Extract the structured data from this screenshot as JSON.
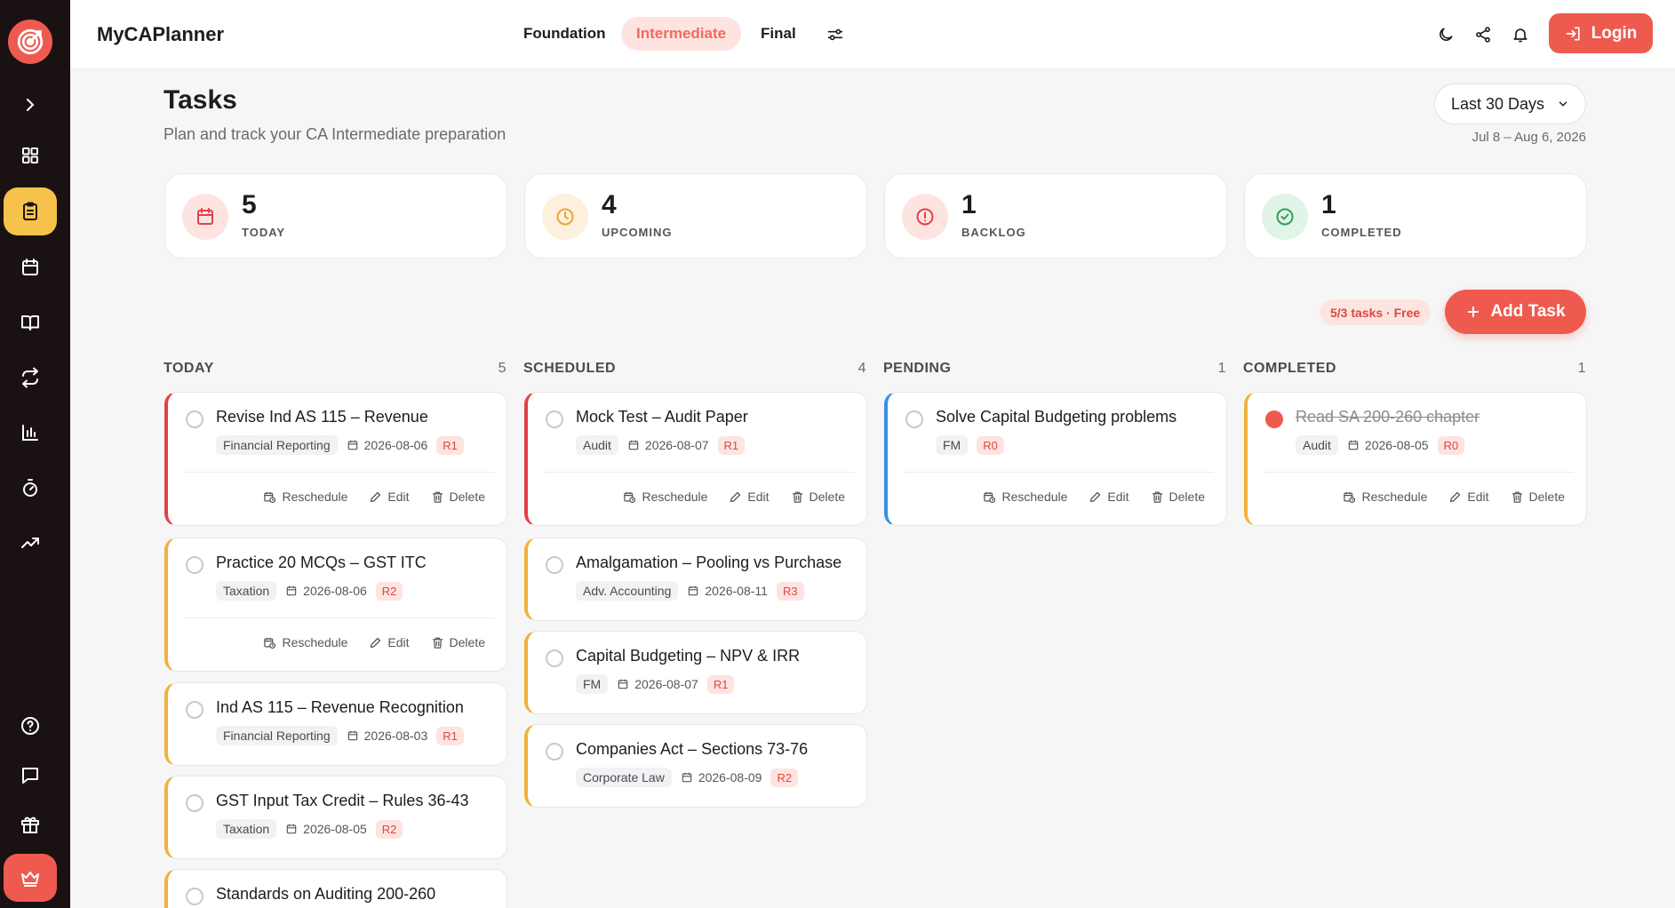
{
  "app": {
    "brand": "MyCAPlanner"
  },
  "header": {
    "tabs": [
      {
        "label": "Foundation",
        "active": false
      },
      {
        "label": "Intermediate",
        "active": true
      },
      {
        "label": "Final",
        "active": false
      }
    ],
    "login_label": "Login"
  },
  "sidebar": {
    "icons": [
      "expand-icon",
      "dashboard-icon",
      "tasks-icon",
      "calendar-icon",
      "book-icon",
      "repeat-icon",
      "bar-chart-icon",
      "timer-icon",
      "trending-icon",
      "help-icon",
      "message-icon",
      "gift-icon",
      "crown-icon"
    ],
    "active": "tasks-icon"
  },
  "page": {
    "title": "Tasks",
    "subtitle": "Plan and track your CA Intermediate preparation",
    "range": {
      "selected": "Last 30 Days",
      "dates": "Jul 8 – Aug 6, 2026"
    }
  },
  "stats": [
    {
      "value": "5",
      "label": "TODAY",
      "color": "#e2404a"
    },
    {
      "value": "4",
      "label": "UPCOMING",
      "color": "#e9a53a"
    },
    {
      "value": "1",
      "label": "BACKLOG",
      "color": "#e2404a"
    },
    {
      "value": "1",
      "label": "COMPLETED",
      "color": "#2e9e5b"
    }
  ],
  "actions": {
    "free_badge": "5/3 tasks · Free",
    "add_task": "Add Task"
  },
  "card_actions": {
    "reschedule": "Reschedule",
    "edit": "Edit",
    "delete": "Delete"
  },
  "columns": [
    {
      "title": "TODAY",
      "count": "5",
      "tasks": [
        {
          "title": "Revise Ind AS 115 – Revenue",
          "subject": "Financial Reporting",
          "date": "2026-08-06",
          "revision": "R1"
        },
        {
          "title": "Practice 20 MCQs – GST ITC",
          "subject": "Taxation",
          "date": "2026-08-06",
          "revision": "R2"
        },
        {
          "title": "Ind AS 115 – Revenue Recognition",
          "subject": "Financial Reporting",
          "date": "2026-08-03",
          "revision": "R1"
        },
        {
          "title": "GST Input Tax Credit – Rules 36-43",
          "subject": "Taxation",
          "date": "2026-08-05",
          "revision": "R2"
        },
        {
          "title": "Standards on Auditing 200-260"
        }
      ]
    },
    {
      "title": "SCHEDULED",
      "count": "4",
      "tasks": [
        {
          "title": "Mock Test – Audit Paper",
          "subject": "Audit",
          "date": "2026-08-07",
          "revision": "R1"
        },
        {
          "title": "Amalgamation – Pooling vs Purchase",
          "subject": "Adv. Accounting",
          "date": "2026-08-11",
          "revision": "R3"
        },
        {
          "title": "Capital Budgeting – NPV & IRR",
          "subject": "FM",
          "date": "2026-08-07",
          "revision": "R1"
        },
        {
          "title": "Companies Act – Sections 73-76",
          "subject": "Corporate Law",
          "date": "2026-08-09",
          "revision": "R2"
        }
      ]
    },
    {
      "title": "PENDING",
      "count": "1",
      "tasks": [
        {
          "title": "Solve Capital Budgeting problems",
          "subject": "FM",
          "date": "",
          "revision": "R0"
        }
      ]
    },
    {
      "title": "COMPLETED",
      "count": "1",
      "tasks": [
        {
          "title": "Read SA 200-260 chapter",
          "subject": "Audit",
          "date": "2026-08-05",
          "revision": "R0"
        }
      ]
    }
  ]
}
